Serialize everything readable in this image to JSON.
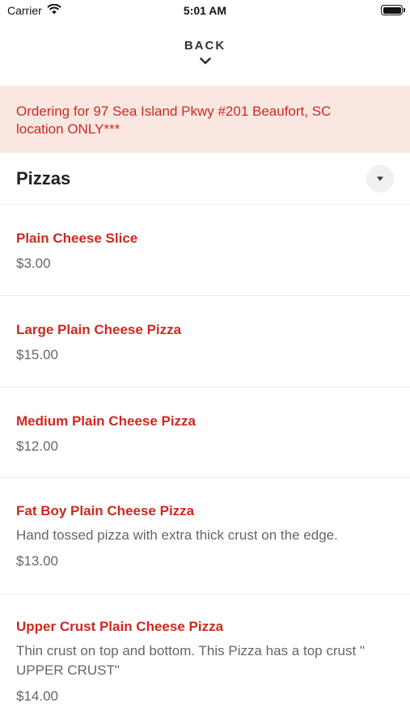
{
  "status": {
    "carrier": "Carrier",
    "time": "5:01 AM"
  },
  "nav": {
    "back_label": "BACK"
  },
  "notice": {
    "text": "Ordering for 97 Sea Island Pkwy #201 Beaufort, SC location ONLY***"
  },
  "category": {
    "title": "Pizzas"
  },
  "items": [
    {
      "name": "Plain Cheese Slice",
      "description": "",
      "price": "$3.00"
    },
    {
      "name": "Large Plain Cheese Pizza",
      "description": "",
      "price": "$15.00"
    },
    {
      "name": "Medium Plain Cheese Pizza",
      "description": "",
      "price": "$12.00"
    },
    {
      "name": "Fat Boy Plain Cheese Pizza",
      "description": "Hand tossed pizza with extra thick crust on the edge.",
      "price": "$13.00"
    },
    {
      "name": "Upper Crust Plain Cheese Pizza",
      "description": "Thin crust on top and bottom. This Pizza has a top crust \" UPPER CRUST\"",
      "price": "$14.00"
    }
  ],
  "colors": {
    "accent": "#cc2a1e",
    "notice_bg": "#fbe7e2"
  },
  "icons": {
    "wifi": "wifi-icon",
    "battery": "battery-icon",
    "back": "chevron-down-icon",
    "dropdown": "caret-down-icon"
  }
}
